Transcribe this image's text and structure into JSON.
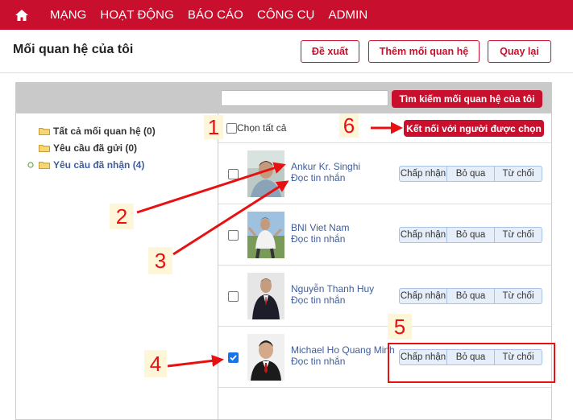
{
  "nav": {
    "items": [
      "MẠNG",
      "HOẠT ĐỘNG",
      "BÁO CÁO",
      "CÔNG CỤ",
      "ADMIN"
    ]
  },
  "header": {
    "title": "Mối quan hệ của tôi",
    "suggest_label": "Đề xuất",
    "add_label": "Thêm mối quan hệ",
    "back_label": "Quay lại"
  },
  "search": {
    "value": "",
    "button_label": "Tìm kiếm mối quan hệ của tôi"
  },
  "tree": {
    "items": [
      {
        "label": "Tất cả mối quan hệ (0)"
      },
      {
        "label": "Yêu cầu đã gửi (0)"
      },
      {
        "label": "Yêu cầu đã nhận (4)"
      }
    ]
  },
  "list": {
    "select_all_label": "Chọn tất cả",
    "connect_label": "Kết nối với người được chọn",
    "rows": [
      {
        "name": "Ankur Kr. Singhi",
        "link": "Đọc tin nhắn",
        "checked": false
      },
      {
        "name": "BNI Viet Nam",
        "link": "Đọc tin nhắn",
        "checked": false
      },
      {
        "name": "Nguyễn Thanh Huy",
        "link": "Đọc tin nhắn",
        "checked": false
      },
      {
        "name": "Michael Ho Quang Minh",
        "link": "Đọc tin nhắn",
        "checked": true
      }
    ],
    "accept_label": "Chấp nhận",
    "skip_label": "Bỏ qua",
    "reject_label": "Từ chối"
  },
  "callouts": [
    "1",
    "2",
    "3",
    "4",
    "5",
    "6"
  ],
  "colors": {
    "brand": "#c8102e",
    "link": "#3f5e9a",
    "annotation": "#e81010"
  }
}
